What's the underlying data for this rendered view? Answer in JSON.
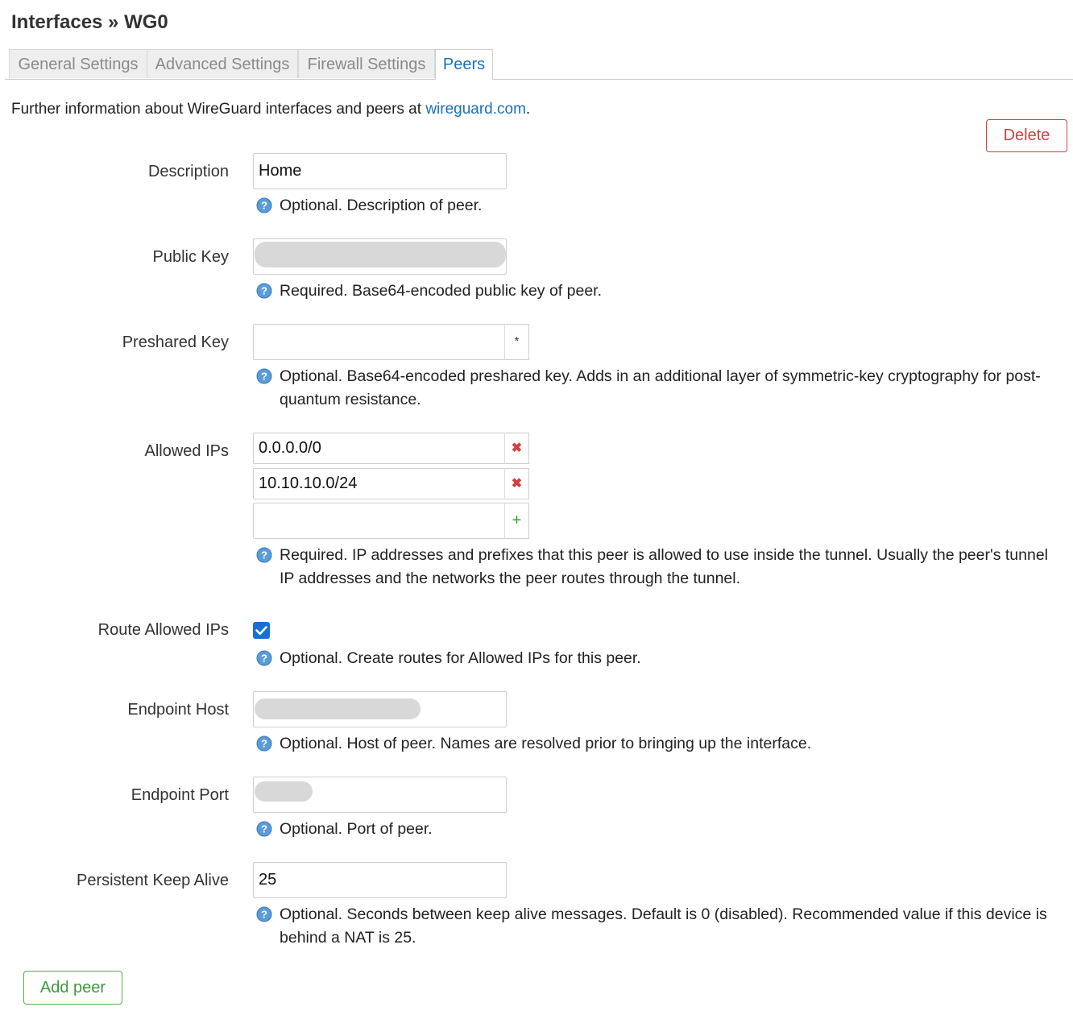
{
  "page": {
    "title": "Interfaces » WG0"
  },
  "tabs": [
    {
      "label": "General Settings"
    },
    {
      "label": "Advanced Settings"
    },
    {
      "label": "Firewall Settings"
    },
    {
      "label": "Peers"
    }
  ],
  "info": {
    "text": "Further information about WireGuard interfaces and peers at ",
    "link": "wireguard.com",
    "suffix": "."
  },
  "delete_label": "Delete",
  "fields": {
    "description": {
      "label": "Description",
      "value": "Home",
      "help": "Optional. Description of peer."
    },
    "public_key": {
      "label": "Public Key",
      "value": "",
      "help": "Required. Base64-encoded public key of peer."
    },
    "preshared_key": {
      "label": "Preshared Key",
      "value": "",
      "button": "*",
      "help": "Optional. Base64-encoded preshared key. Adds in an additional layer of symmetric-key cryptography for post-quantum resistance."
    },
    "allowed_ips": {
      "label": "Allowed IPs",
      "values": [
        "0.0.0.0/0",
        "10.10.10.0/24",
        ""
      ],
      "remove": "✖",
      "add": "+",
      "help": "Required. IP addresses and prefixes that this peer is allowed to use inside the tunnel. Usually the peer's tunnel IP addresses and the networks the peer routes through the tunnel."
    },
    "route_allowed_ips": {
      "label": "Route Allowed IPs",
      "checked": true,
      "help": "Optional. Create routes for Allowed IPs for this peer."
    },
    "endpoint_host": {
      "label": "Endpoint Host",
      "value": "",
      "help": "Optional. Host of peer. Names are resolved prior to bringing up the interface."
    },
    "endpoint_port": {
      "label": "Endpoint Port",
      "value": "",
      "help": "Optional. Port of peer."
    },
    "keep_alive": {
      "label": "Persistent Keep Alive",
      "value": "25",
      "help": "Optional. Seconds between keep alive messages. Default is 0 (disabled). Recommended value if this device is behind a NAT is 25."
    }
  },
  "add_peer_label": "Add peer",
  "colors": {
    "accent": "#1a6fc0",
    "danger": "#d33f3f",
    "success": "#4caf50",
    "checkbox": "#1a6fd6"
  }
}
